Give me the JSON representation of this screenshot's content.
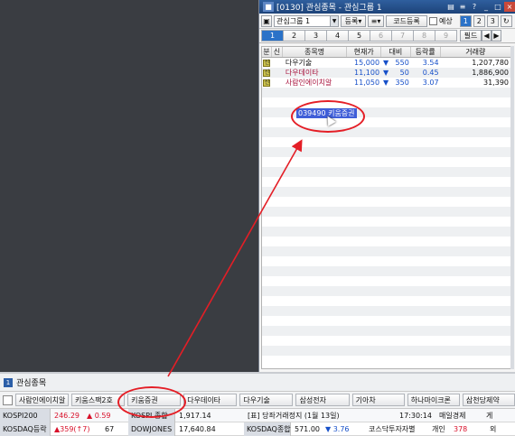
{
  "window": {
    "title": "[0130] 관심종목 - 관심그룹 1",
    "buttons": [
      "▤",
      "≡",
      "?",
      "_",
      "□",
      "×"
    ]
  },
  "toolbar": {
    "group_select": "관심그룹 1",
    "register": "등록",
    "code_register": "코드등록",
    "forecast_label": "예상",
    "pages": [
      "1",
      "2",
      "3",
      "↻"
    ],
    "field": "필드",
    "prev": "◀",
    "next": "▶"
  },
  "tabs": [
    "1",
    "2",
    "3",
    "4",
    "5",
    "6",
    "7",
    "8",
    "9"
  ],
  "grid": {
    "headers": [
      "분",
      "신",
      "종목명",
      "현재가",
      "대비",
      "등락률",
      "거래량"
    ],
    "rows": [
      {
        "badge": "신",
        "name": "다우기술",
        "price": "15,000",
        "dir": "▼",
        "diff": "550",
        "rate": "3.54",
        "volume": "1,207,780",
        "name_color": "#111111"
      },
      {
        "badge": "신",
        "name": "다우데이타",
        "price": "11,100",
        "dir": "▼",
        "diff": "50",
        "rate": "0.45",
        "volume": "1,886,900",
        "name_color": "#a8123c"
      },
      {
        "badge": "신",
        "name": "사람인에이치알",
        "price": "11,050",
        "dir": "▼",
        "diff": "350",
        "rate": "3.07",
        "volume": "31,390",
        "name_color": "#a8123c"
      }
    ],
    "drag_label": "039490 키움증권"
  },
  "bottom": {
    "title": "관심종목",
    "quick_items": [
      "사람인에이치알",
      "키움스팩2호",
      "키움증권",
      "다우데이타",
      "다우기술",
      "삼성전자",
      "기아차",
      "하나마이크론",
      "삼천당제약"
    ],
    "row1": {
      "kospi200_name": "KOSPI200",
      "kospi200_val": "246.29",
      "kospi200_chg": "▲ 0.59",
      "kospi_name": "KOSPI 종합",
      "kospi_val": "1,917.14",
      "news": "[표] 당좌거래정지 (1월 13일)",
      "time": "17:30:14",
      "source": "매일경제",
      "right": "게"
    },
    "row2": {
      "kosdaq_rise_name": "KOSDAQ등락",
      "kosdaq_rise_val": "▲359(↑7)",
      "kosdaq_rise_n": "67",
      "dow_name": "DOWJONES",
      "dow_val": "17,640.84",
      "kosdaq_name": "KOSDAQ종합",
      "kosdaq_val": "571.00",
      "kosdaq_chg": "▼ 3.76",
      "investor": "코스닥투자자별",
      "investor_kind": "개인",
      "investor_val": "378",
      "right": "외"
    }
  },
  "colors": {
    "annotation": "#e41e26",
    "selected": "#2b72c8",
    "up": "#d8102a",
    "down": "#1750c9"
  }
}
